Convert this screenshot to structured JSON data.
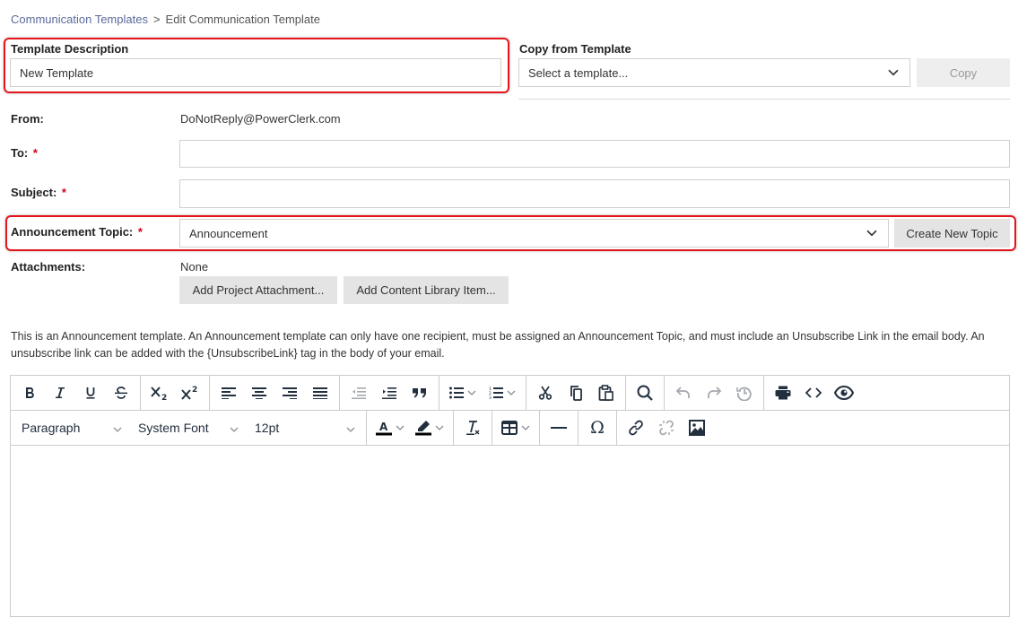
{
  "breadcrumb": {
    "parent": "Communication Templates",
    "separator": ">",
    "current": "Edit Communication Template"
  },
  "template_description": {
    "label": "Template Description",
    "value": "New Template"
  },
  "copy_from_template": {
    "label": "Copy from Template",
    "placeholder": "Select a template...",
    "button_label": "Copy"
  },
  "form": {
    "from": {
      "label": "From:",
      "value": "DoNotReply@PowerClerk.com"
    },
    "to": {
      "label": "To:",
      "required_mark": "*",
      "value": ""
    },
    "subject": {
      "label": "Subject:",
      "required_mark": "*",
      "value": ""
    },
    "announcement_topic": {
      "label": "Announcement Topic:",
      "required_mark": "*",
      "value": "Announcement",
      "create_button_label": "Create New Topic"
    },
    "attachments": {
      "label": "Attachments:",
      "value": "None",
      "add_project_attachment_label": "Add Project Attachment...",
      "add_content_library_label": "Add Content Library Item..."
    }
  },
  "info_text": "This is an Announcement template. An Announcement template can only have one recipient, must be assigned an Announcement Topic, and must include an Unsubscribe Link in the email body. An unsubscribe link can be added with the {UnsubscribeLink} tag in the body of your email.",
  "editor": {
    "block_format": "Paragraph",
    "font_family": "System Font",
    "font_size": "12pt",
    "toolbar_row1": [
      "bold",
      "italic",
      "underline",
      "strikethrough",
      "subscript",
      "superscript",
      "align-left",
      "align-center",
      "align-right",
      "align-justify",
      "outdent",
      "indent",
      "blockquote",
      "bullet-list",
      "numbered-list",
      "cut",
      "copy",
      "paste",
      "find",
      "undo",
      "redo",
      "restore-draft",
      "print",
      "source-code",
      "preview"
    ],
    "toolbar_row2": [
      "block-format",
      "font-family",
      "font-size",
      "text-color",
      "highlight-color",
      "clear-formatting",
      "table",
      "horizontal-line",
      "special-character",
      "link",
      "unlink",
      "image"
    ],
    "content": ""
  },
  "colors": {
    "highlight_border": "#e5141b",
    "required": "#d0021b",
    "link": "#5a6a9c",
    "icon": "#222f3e",
    "icon_disabled": "#a5a9ae"
  }
}
